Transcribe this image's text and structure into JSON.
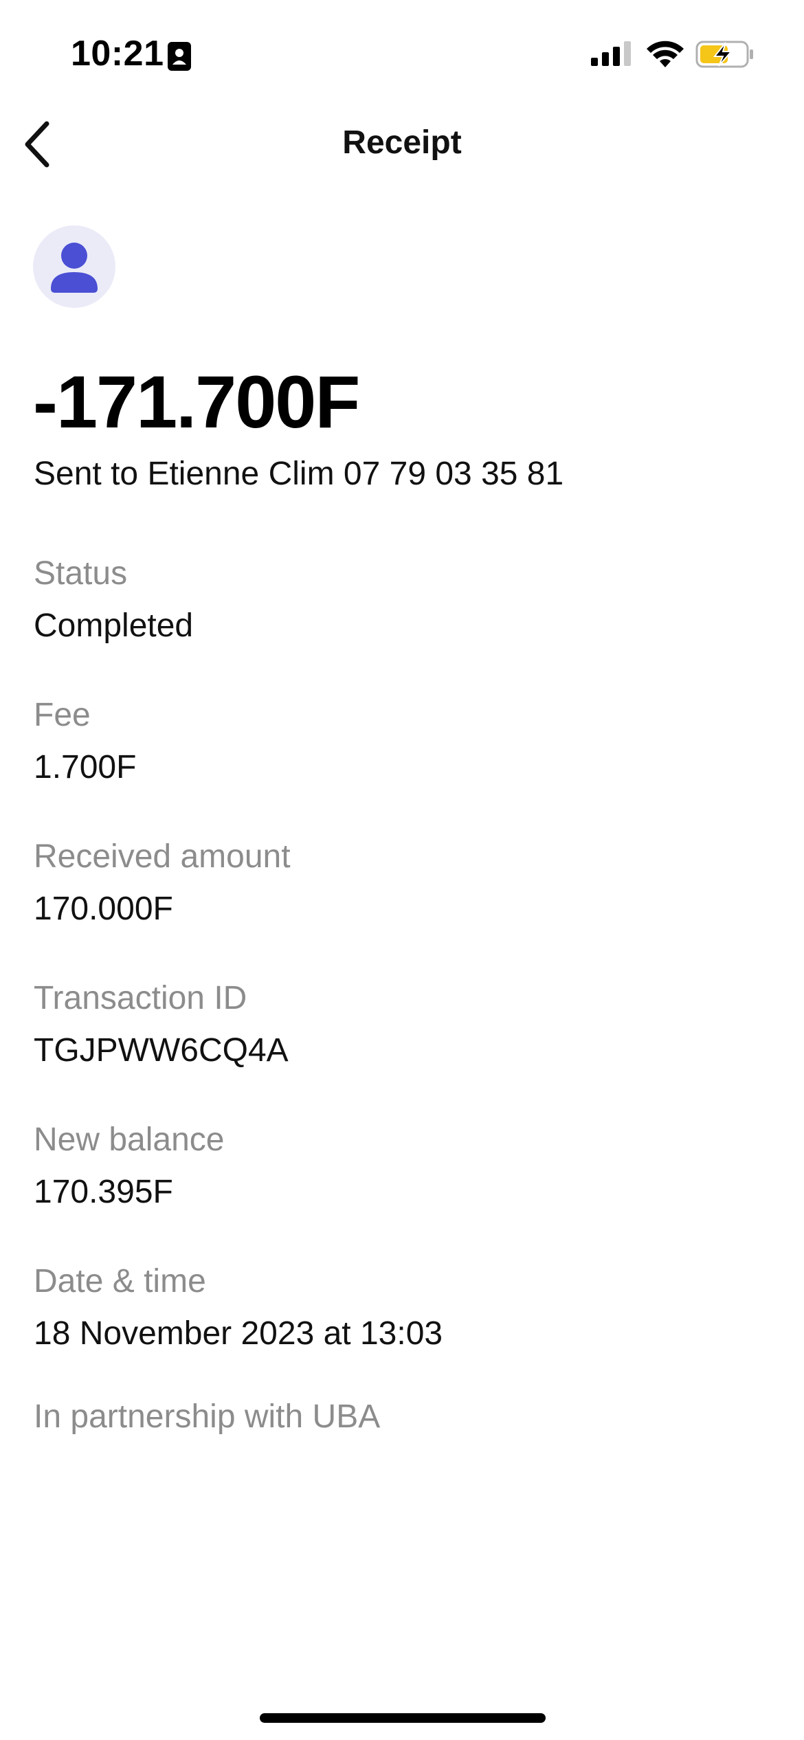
{
  "status_bar": {
    "time": "10:21"
  },
  "nav": {
    "title": "Receipt"
  },
  "receipt": {
    "amount": "-171.700F",
    "recipient_line": "Sent to Etienne Clim 07 79 03 35 81",
    "details": [
      {
        "label": "Status",
        "value": "Completed"
      },
      {
        "label": "Fee",
        "value": "1.700F"
      },
      {
        "label": "Received amount",
        "value": "170.000F"
      },
      {
        "label": "Transaction ID",
        "value": "TGJPWW6CQ4A"
      },
      {
        "label": "New balance",
        "value": "170.395F"
      },
      {
        "label": "Date & time",
        "value": "18 November 2023 at 13:03"
      }
    ],
    "partnership": "In partnership with UBA"
  },
  "colors": {
    "accent": "#4a4fd4",
    "avatar_bg": "#ebebf8",
    "label_gray": "#8c8c8c",
    "battery_fill": "#f5c518"
  },
  "icons": [
    "id-card-icon",
    "signal-icon",
    "wifi-icon",
    "battery-charging-icon",
    "chevron-left-icon",
    "person-icon"
  ]
}
